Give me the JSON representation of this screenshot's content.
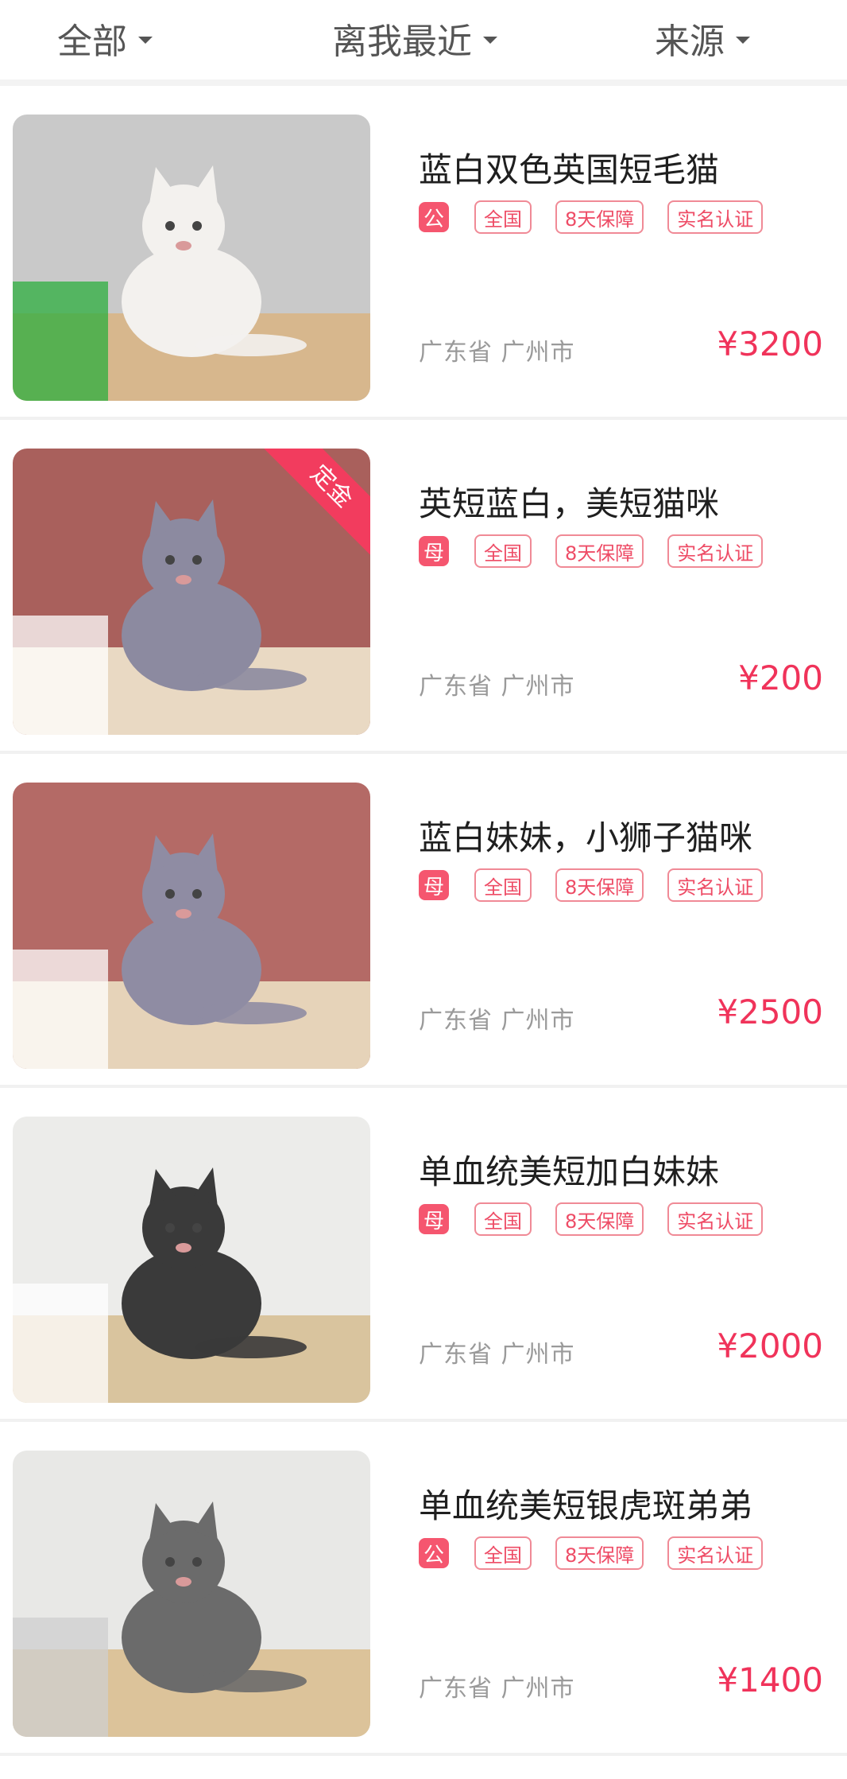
{
  "filters": [
    {
      "label": "全部"
    },
    {
      "label": "离我最近"
    },
    {
      "label": "来源"
    }
  ],
  "listings": [
    {
      "title": "蓝白双色英国短毛猫",
      "badge": "公",
      "tags": [
        "全国",
        "8天保障",
        "实名认证"
      ],
      "location": "广东省 广州市",
      "price": "¥3200",
      "ribbon": "",
      "photo": {
        "bg": "#c9c9c9",
        "cat": "#f3f1ee",
        "accent": "#2cae3d",
        "floor": "#d7b78d"
      }
    },
    {
      "title": "英短蓝白，美短猫咪",
      "badge": "母",
      "tags": [
        "全国",
        "8天保障",
        "实名认证"
      ],
      "location": "广东省 广州市",
      "price": "¥200",
      "ribbon": "定金",
      "photo": {
        "bg": "#a9605c",
        "cat": "#8c8aa0",
        "accent": "#ffffff",
        "floor": "#e9d9c3"
      }
    },
    {
      "title": "蓝白妹妹，小狮子猫咪",
      "badge": "母",
      "tags": [
        "全国",
        "8天保障",
        "实名认证"
      ],
      "location": "广东省 广州市",
      "price": "¥2500",
      "ribbon": "",
      "photo": {
        "bg": "#b46a66",
        "cat": "#8f8ca3",
        "accent": "#ffffff",
        "floor": "#e6d3b9"
      }
    },
    {
      "title": "单血统美短加白妹妹",
      "badge": "母",
      "tags": [
        "全国",
        "8天保障",
        "实名认证"
      ],
      "location": "广东省 广州市",
      "price": "¥2000",
      "ribbon": "",
      "photo": {
        "bg": "#ececea",
        "cat": "#3a3a3a",
        "accent": "#ffffff",
        "floor": "#d9c49e"
      }
    },
    {
      "title": "单血统美短银虎斑弟弟",
      "badge": "公",
      "tags": [
        "全国",
        "8天保障",
        "实名认证"
      ],
      "location": "广东省 广州市",
      "price": "¥1400",
      "ribbon": "",
      "photo": {
        "bg": "#e8e8e6",
        "cat": "#6b6b6b",
        "accent": "#cfcfcf",
        "floor": "#dcc39a"
      }
    }
  ]
}
